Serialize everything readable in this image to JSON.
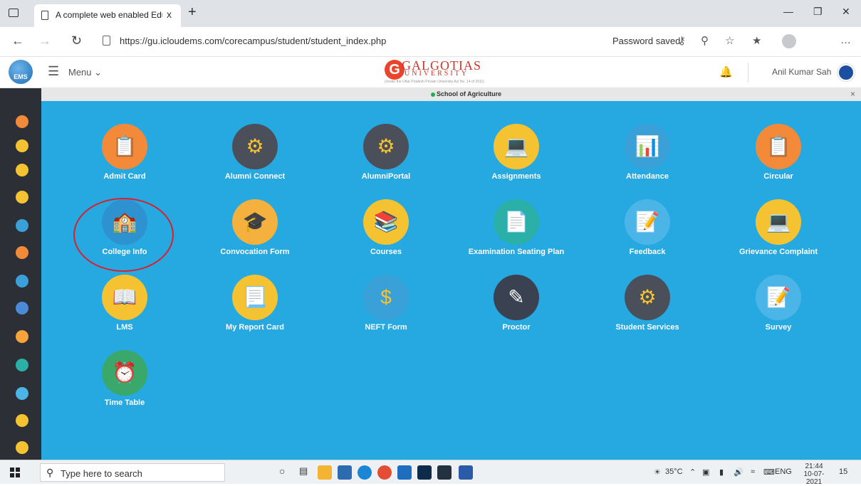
{
  "browser": {
    "tab_title": "A complete web enabled Educati",
    "tab_close": "x",
    "new_tab": "+",
    "url": "https://gu.icloudems.com/corecampus/student/student_index.php",
    "password_saved": "Password saved"
  },
  "header": {
    "logo_text": "EMS",
    "menu_label": "Menu",
    "brand_line1": "GALGOTIAS",
    "brand_line2": "UNIVERSITY",
    "brand_tagline": "(Under the Uttar Pradesh Private University Act No. 14 of 2011)",
    "user_name": "Anil Kumar Sah"
  },
  "school_strip": {
    "label": "School of Agriculture",
    "close": "×"
  },
  "tiles": [
    {
      "label": "Admit Card",
      "icon": "clipboard-icon",
      "color": "#f28a3a"
    },
    {
      "label": "Alumni Connect",
      "icon": "gears-icon",
      "color": "#4a4f5a"
    },
    {
      "label": "AlumniPortal",
      "icon": "gears-icon",
      "color": "#4a4f5a"
    },
    {
      "label": "Assignments",
      "icon": "student-laptop-icon",
      "color": "#f5c331"
    },
    {
      "label": "Attendance",
      "icon": "presentation-icon",
      "color": "#3aa0d8"
    },
    {
      "label": "Circular",
      "icon": "clipboard-icon",
      "color": "#f28a3a"
    },
    {
      "label": "College Info",
      "icon": "building-icon",
      "color": "#2d92cf"
    },
    {
      "label": "Convocation Form",
      "icon": "graduate-icon",
      "color": "#f5b13d"
    },
    {
      "label": "Courses",
      "icon": "books-icon",
      "color": "#f5c331"
    },
    {
      "label": "Examination Seating Plan",
      "icon": "exam-sheet-icon",
      "color": "#2ab0a6"
    },
    {
      "label": "Feedback",
      "icon": "form-icon",
      "color": "#4cb5e8"
    },
    {
      "label": "Grievance Complaint",
      "icon": "student-laptop-icon",
      "color": "#f5c331"
    },
    {
      "label": "LMS",
      "icon": "books-stack-icon",
      "color": "#f5c331"
    },
    {
      "label": "My Report Card",
      "icon": "report-card-icon",
      "color": "#f5c331"
    },
    {
      "label": "NEFT Form",
      "icon": "money-transfer-icon",
      "color": "#3aa0d8"
    },
    {
      "label": "Proctor",
      "icon": "document-pen-icon",
      "color": "#3a4150"
    },
    {
      "label": "Student Services",
      "icon": "gears-icon",
      "color": "#4a4f5a"
    },
    {
      "label": "Survey",
      "icon": "form-icon",
      "color": "#4cb5e8"
    },
    {
      "label": "Time Table",
      "icon": "alarm-clock-icon",
      "color": "#3aa86a"
    }
  ],
  "taskbar": {
    "search_placeholder": "Type here to search",
    "temperature": "35°C",
    "language": "ENG",
    "time": "21:44",
    "date": "10-07-2021",
    "notifications": "15"
  }
}
